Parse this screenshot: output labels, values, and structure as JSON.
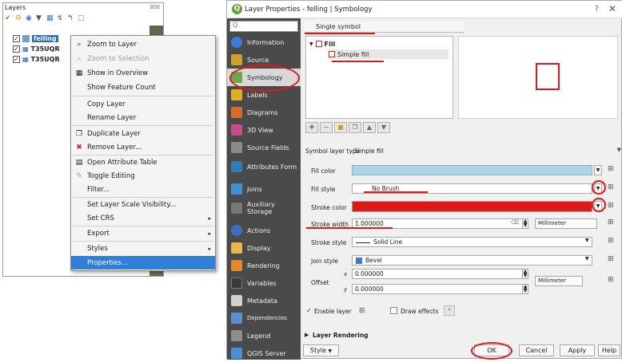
{
  "layers_panel": {
    "title": "Layers",
    "controls": "☒☒",
    "layers": [
      {
        "name": "felling",
        "checked": true,
        "selected": true
      },
      {
        "name": "T35UQR",
        "checked": true,
        "selected": false
      },
      {
        "name": "T35UQR",
        "checked": true,
        "selected": false
      }
    ]
  },
  "context_menu": {
    "items": [
      {
        "label": "Zoom to Layer",
        "icon": "⌕",
        "disabled": false
      },
      {
        "label": "Zoom to Selection",
        "icon": "⌕",
        "disabled": true
      },
      {
        "label": "Show in Overview",
        "icon": "▦",
        "disabled": false
      },
      {
        "label": "Show Feature Count",
        "icon": "",
        "disabled": false
      },
      {
        "label": "Copy Layer",
        "icon": "",
        "disabled": false
      },
      {
        "label": "Rename Layer",
        "icon": "",
        "disabled": false
      },
      {
        "label": "Duplicate Layer",
        "icon": "❐",
        "disabled": false
      },
      {
        "label": "Remove Layer...",
        "icon": "✖",
        "disabled": false
      },
      {
        "label": "Open Attribute Table",
        "icon": "▤",
        "disabled": false
      },
      {
        "label": "Toggle Editing",
        "icon": "✎",
        "disabled": false
      },
      {
        "label": "Filter...",
        "icon": "",
        "disabled": false
      },
      {
        "label": "Set Layer Scale Visibility...",
        "icon": "",
        "disabled": false
      },
      {
        "label": "Set CRS",
        "icon": "",
        "disabled": false,
        "submenu": true
      },
      {
        "label": "Export",
        "icon": "",
        "disabled": false,
        "submenu": true
      },
      {
        "label": "Styles",
        "icon": "",
        "disabled": false,
        "submenu": true
      },
      {
        "label": "Properties...",
        "icon": "",
        "disabled": false,
        "highlighted": true
      }
    ]
  },
  "dialog": {
    "title": "Layer Properties - felling | Symbology",
    "help": "?",
    "close": "✕",
    "nav_search_placeholder": "Q",
    "nav": [
      {
        "label": "Information",
        "color": "#3a7bd5"
      },
      {
        "label": "Source",
        "color": "#c9a227"
      },
      {
        "label": "Symbology",
        "color": "#6aa84f",
        "active": true
      },
      {
        "label": "Labels",
        "color": "#e0b020"
      },
      {
        "label": "Diagrams",
        "color": "#d86c2a"
      },
      {
        "label": "3D View",
        "color": "#c94b8f"
      },
      {
        "label": "Source Fields",
        "color": "#8a8a8a"
      },
      {
        "label": "Attributes Form",
        "color": "#2e7bb8"
      },
      {
        "label": "Joins",
        "color": "#3d8fd6"
      },
      {
        "label": "Auxiliary Storage",
        "color": "#777777"
      },
      {
        "label": "Actions",
        "color": "#3b6fc2"
      },
      {
        "label": "Display",
        "color": "#e8b84a"
      },
      {
        "label": "Rendering",
        "color": "#e28a2b"
      },
      {
        "label": "Variables",
        "color": "#3a3a3a"
      },
      {
        "label": "Metadata",
        "color": "#d0d0d0"
      },
      {
        "label": "Dependencies",
        "color": "#5b8fd0"
      },
      {
        "label": "Legend",
        "color": "#8c8c8c"
      },
      {
        "label": "QGIS Server",
        "color": "#4a90d9"
      }
    ],
    "symbol_mode": "Single symbol",
    "tree": {
      "root": "Fill",
      "child": "Simple fill"
    },
    "symbol_layer_type_label": "Symbol layer type",
    "symbol_layer_type_value": "Simple fill",
    "form": {
      "fill_color_label": "Fill color",
      "fill_color": "#a9d6ec",
      "fill_style_label": "Fill style",
      "fill_style_value": "No Brush",
      "stroke_color_label": "Stroke color",
      "stroke_color": "#e01818",
      "stroke_width_label": "Stroke width",
      "stroke_width_value": "1.000000",
      "stroke_width_unit": "Millimeter",
      "stroke_style_label": "Stroke style",
      "stroke_style_value": "Solid Line",
      "join_style_label": "Join style",
      "join_style_value": "Bevel",
      "offset_label": "Offset",
      "offset_x_label": "x",
      "offset_x": "0.000000",
      "offset_y_label": "y",
      "offset_y": "0.000000",
      "offset_unit": "Millimeter"
    },
    "enable_layer_label": "Enable layer",
    "draw_effects_label": "Draw effects",
    "layer_rendering_label": "Layer Rendering",
    "buttons": {
      "style": "Style",
      "ok": "OK",
      "cancel": "Cancel",
      "apply": "Apply",
      "help": "Help"
    },
    "annotation_color": "#e01818"
  }
}
